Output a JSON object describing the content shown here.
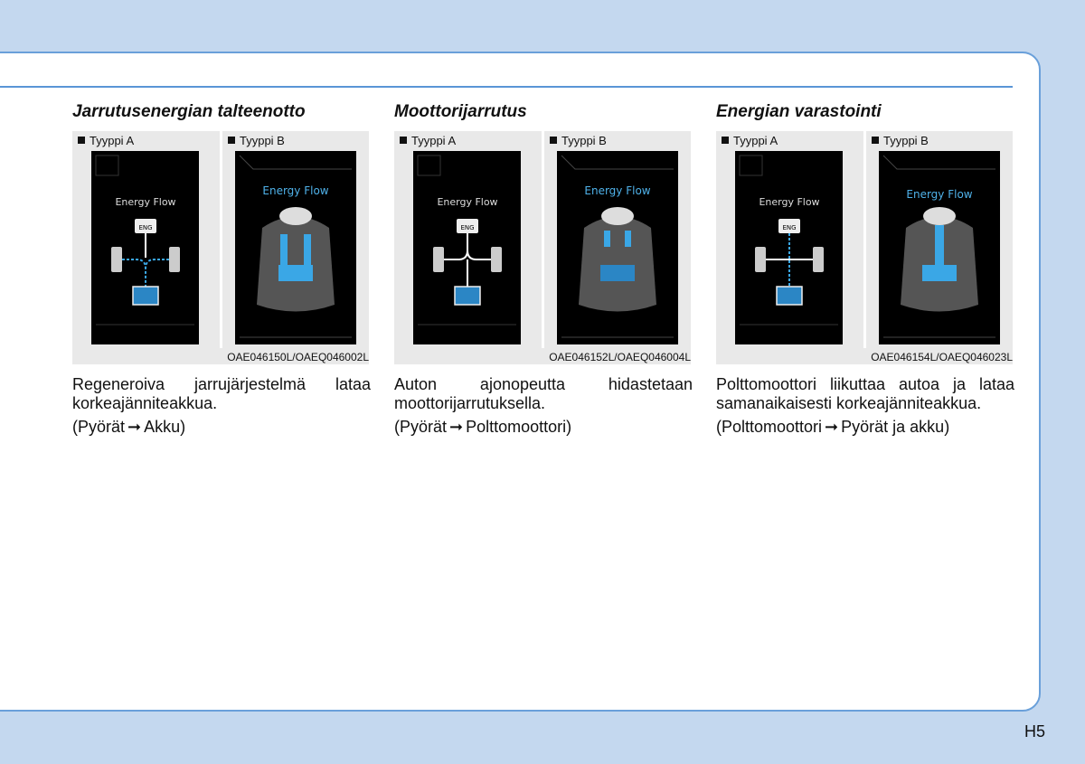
{
  "page_number": "H5",
  "sections": [
    {
      "title": "Jarrutusenergian talteenotto",
      "type_a_label": "Tyyppi A",
      "type_b_label": "Tyyppi B",
      "screen_title": "Energy Flow",
      "engine_label": "ENG",
      "image_code": "OAE046150L/OAEQ046002L",
      "description": "Regeneroiva jarrujärjestelmä lataa korkeajänniteakkua.",
      "flow_from": "(Pyörät",
      "flow_arrow": "➞",
      "flow_to": "Akku)"
    },
    {
      "title": "Moottorijarrutus",
      "type_a_label": "Tyyppi A",
      "type_b_label": "Tyyppi B",
      "screen_title": "Energy Flow",
      "engine_label": "ENG",
      "image_code": "OAE046152L/OAEQ046004L",
      "description": "Auton ajonopeutta hidastetaan moottorijarrutuksella.",
      "flow_from": "(Pyörät",
      "flow_arrow": "➞",
      "flow_to": "Polttomoottori)"
    },
    {
      "title": "Energian varastointi",
      "type_a_label": "Tyyppi A",
      "type_b_label": "Tyyppi B",
      "screen_title": "Energy Flow",
      "engine_label": "ENG",
      "image_code": "OAE046154L/OAEQ046023L",
      "description": "Polttomoottori liikuttaa autoa ja lataa samanaikaisesti korkeajänniteakkua.",
      "flow_from": "(Polttomoottori",
      "flow_arrow": "➞",
      "flow_to": "Pyörät ja akku)"
    }
  ],
  "colors": {
    "accent_blue": "#5a95d6",
    "flow_blue": "#3aa7e6",
    "battery_blue": "#2b86c5"
  }
}
